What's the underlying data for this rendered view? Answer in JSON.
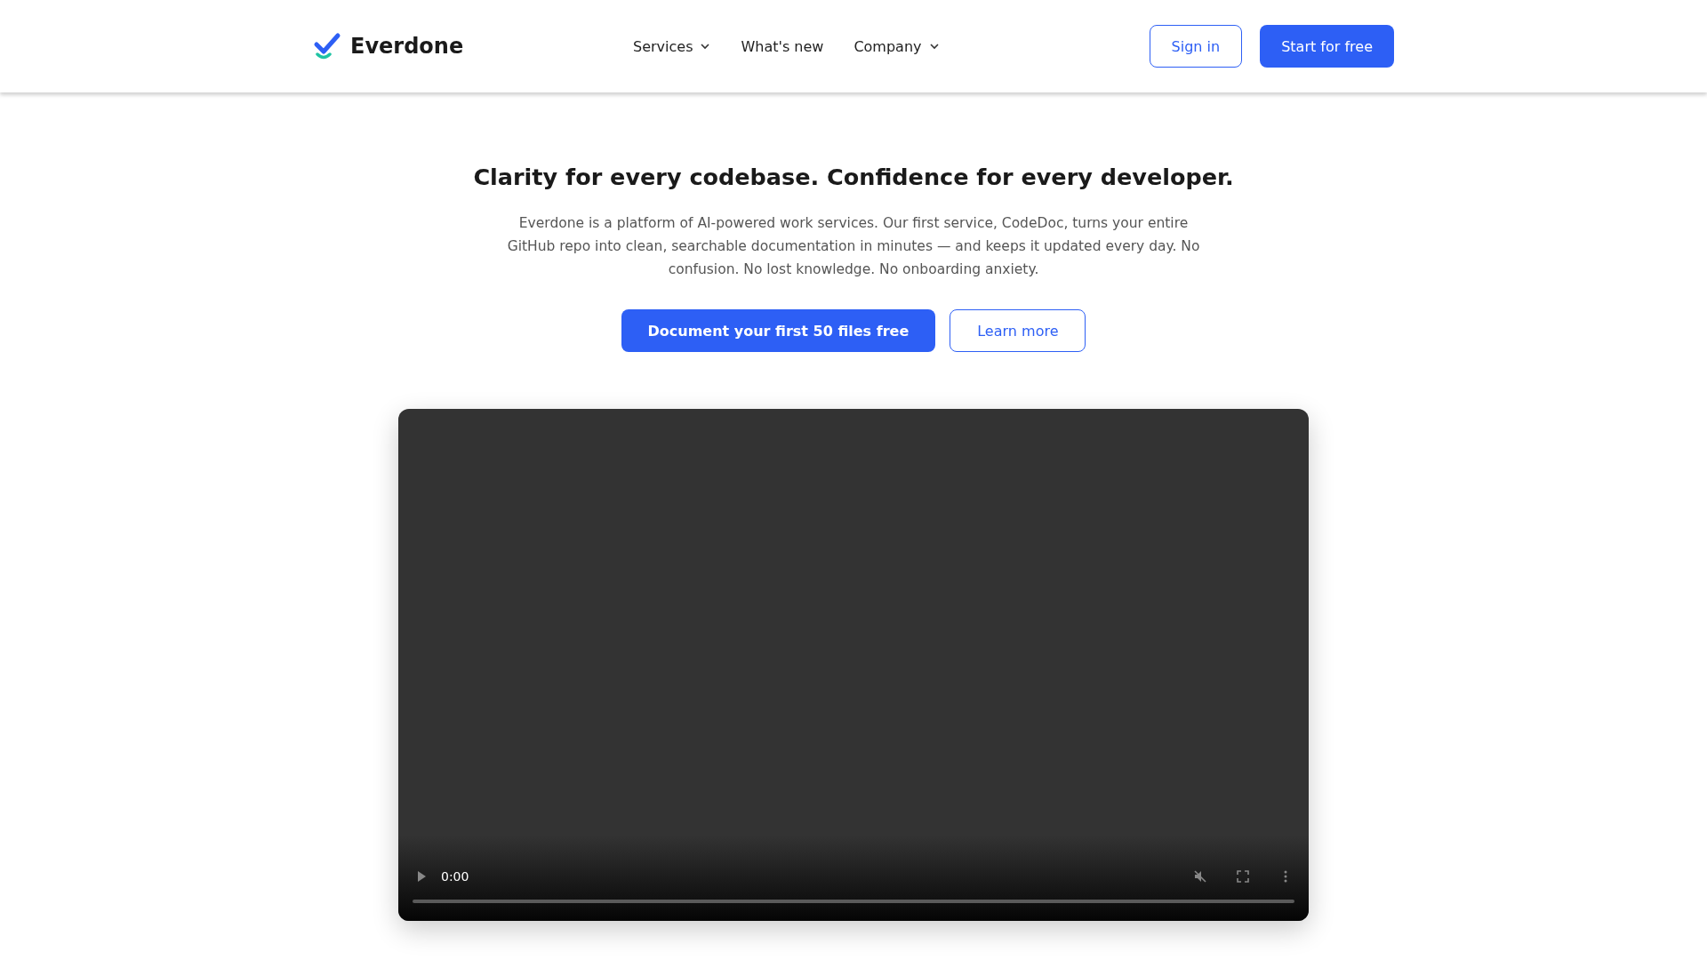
{
  "header": {
    "logo": "Everdone",
    "nav": [
      {
        "label": "Services",
        "dropdown": true
      },
      {
        "label": "What's new",
        "dropdown": false
      },
      {
        "label": "Company",
        "dropdown": true
      }
    ],
    "sign_in": "Sign in",
    "start": "Start for free"
  },
  "hero": {
    "title": "Clarity for every codebase. Confidence for every developer.",
    "description": "Everdone is a platform of AI-powered work services. Our first service, CodeDoc, turns your entire GitHub repo into clean, searchable documentation in minutes — and keeps it updated every day. No confusion. No lost knowledge. No onboarding anxiety.",
    "primary_button": "Document your first 50 files free",
    "secondary_button": "Learn more"
  },
  "video": {
    "time": "0:00",
    "muted": true,
    "level": 0
  }
}
